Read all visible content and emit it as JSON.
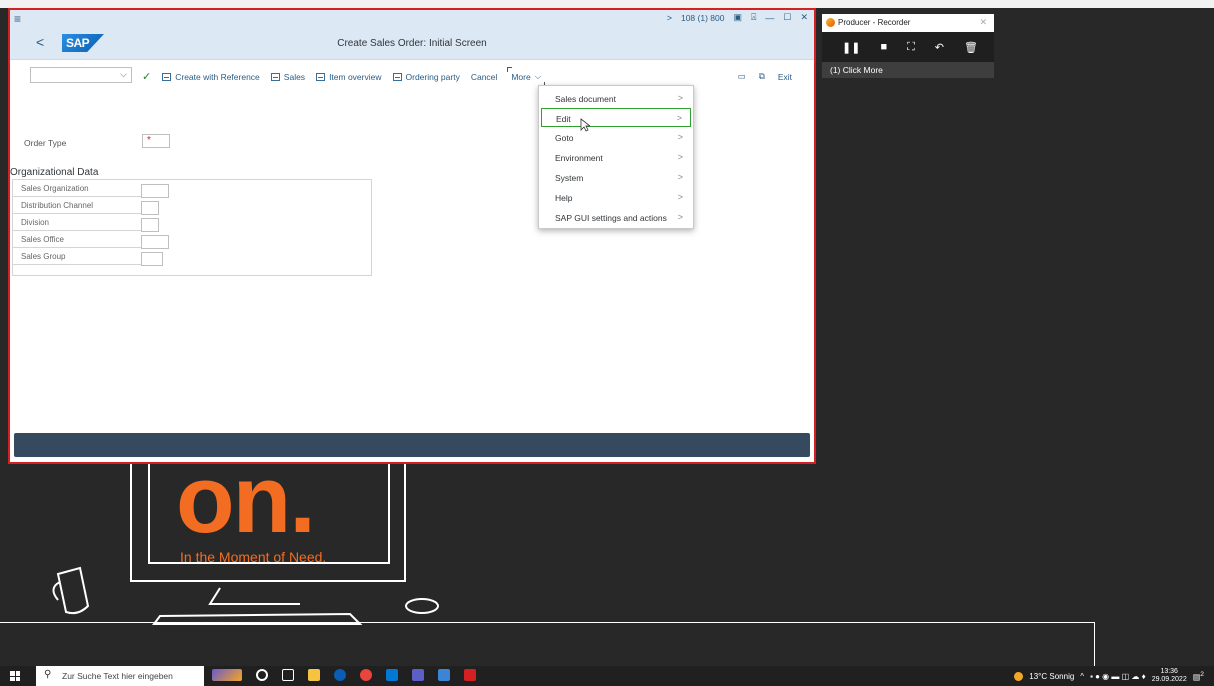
{
  "sap": {
    "system_info": "108 (1) 800",
    "title": "Create Sales Order: Initial Screen",
    "logo_text": "SAP",
    "toolbar": {
      "create_with_reference": "Create with Reference",
      "sales": "Sales",
      "item_overview": "Item overview",
      "ordering_party": "Ordering party",
      "cancel": "Cancel",
      "more": "More",
      "exit": "Exit"
    },
    "order_type_label": "Order Type",
    "required_marker": "*",
    "org_title": "Organizational Data",
    "org_fields": [
      "Sales Organization",
      "Distribution Channel",
      "Division",
      "Sales Office",
      "Sales Group"
    ],
    "menu": [
      {
        "label": "Sales document"
      },
      {
        "label": "Edit"
      },
      {
        "label": "Goto"
      },
      {
        "label": "Environment"
      },
      {
        "label": "System"
      },
      {
        "label": "Help"
      },
      {
        "label": "SAP GUI settings and actions"
      }
    ]
  },
  "recorder": {
    "title": "Producer - Recorder",
    "step": "(1) Click More"
  },
  "background": {
    "big_text": "on.",
    "tagline": "In the Moment of Need."
  },
  "taskbar": {
    "search_placeholder": "Zur Suche Text hier eingeben",
    "weather": "13°C Sonnig",
    "time": "13:36",
    "date": "29.09.2022",
    "notif_count": "2"
  },
  "colors": {
    "accent_orange": "#f26d21",
    "sap_header": "#dce8f3",
    "status_bar": "#354a5f",
    "window_border": "#d42020"
  }
}
